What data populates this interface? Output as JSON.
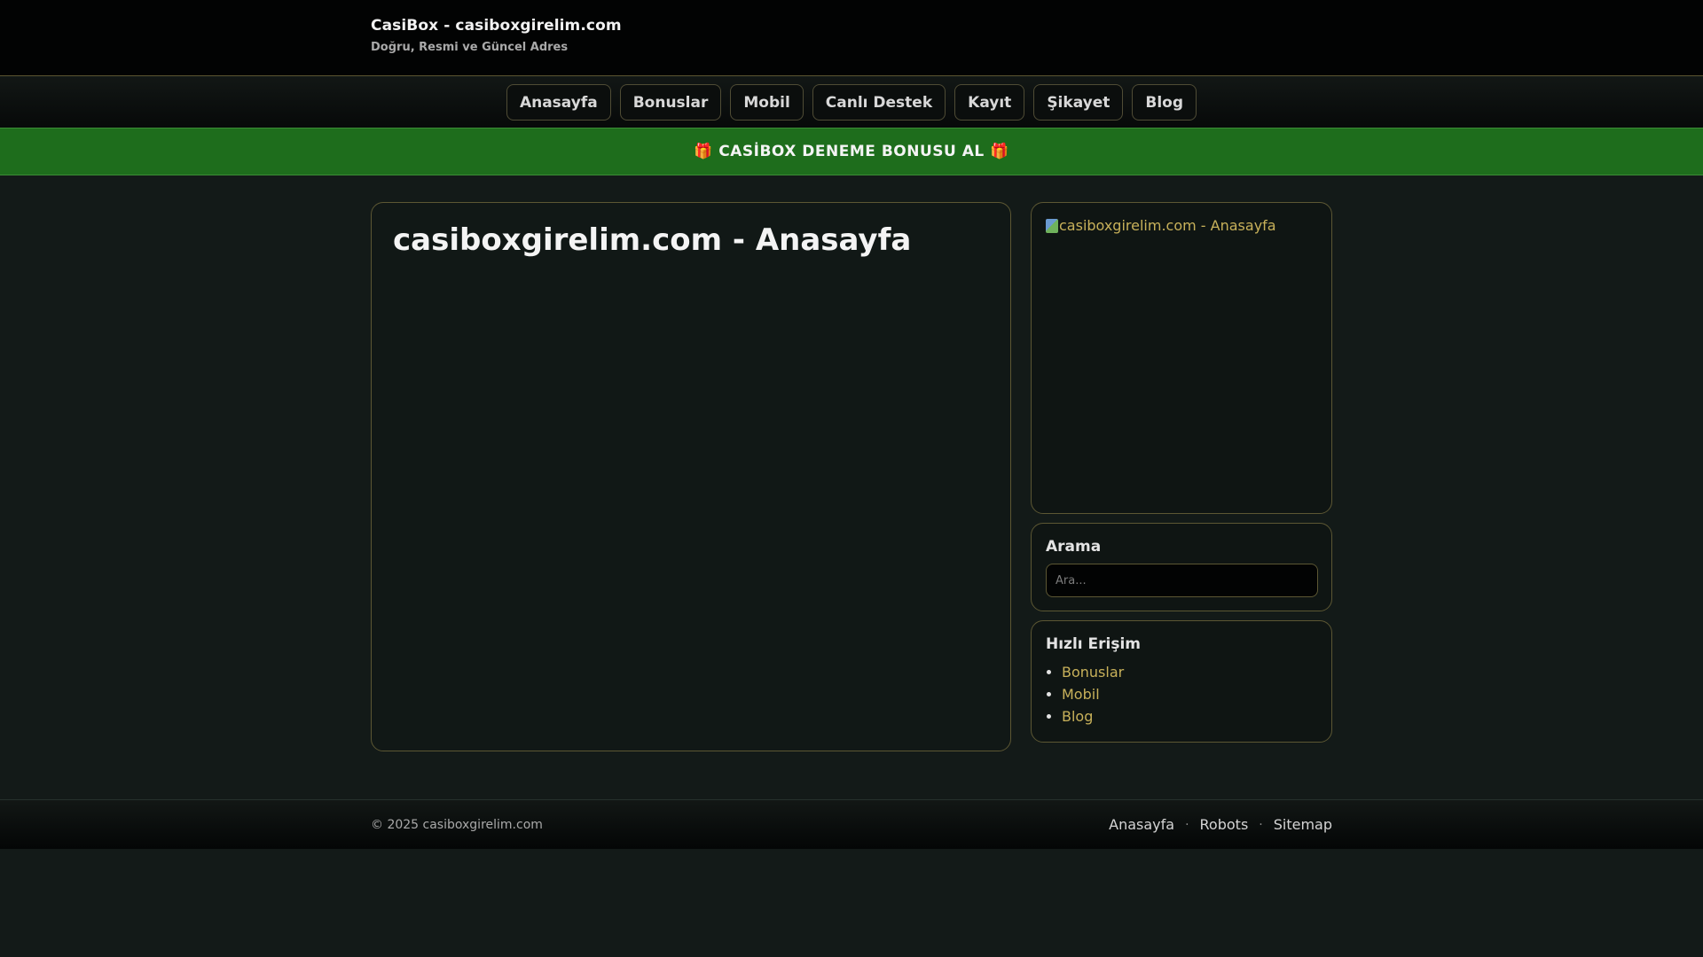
{
  "header": {
    "site_title": "CasiBox - casiboxgirelim.com",
    "tagline": "Doğru, Resmi ve Güncel Adres"
  },
  "nav": {
    "items": [
      "Anasayfa",
      "Bonuslar",
      "Mobil",
      "Canlı Destek",
      "Kayıt",
      "Şikayet",
      "Blog"
    ]
  },
  "promo": {
    "text": "🎁 CASİBOX DENEME BONUSU AL 🎁"
  },
  "main": {
    "title": "casiboxgirelim.com - Anasayfa"
  },
  "sidebar": {
    "image_alt": "casiboxgirelim.com - Anasayfa",
    "search": {
      "title": "Arama",
      "placeholder": "Ara..."
    },
    "quick_access": {
      "title": "Hızlı Erişim",
      "links": [
        "Bonuslar",
        "Mobil",
        "Blog"
      ]
    }
  },
  "footer": {
    "copyright": "© 2025 casiboxgirelim.com",
    "links": [
      "Anasayfa",
      "Robots",
      "Sitemap"
    ],
    "separator": "·"
  },
  "colors": {
    "page_bg": "#131a18",
    "accent_gold": "#c8b15a",
    "promo_green": "#1e6d1c",
    "border": "#5c5733"
  }
}
